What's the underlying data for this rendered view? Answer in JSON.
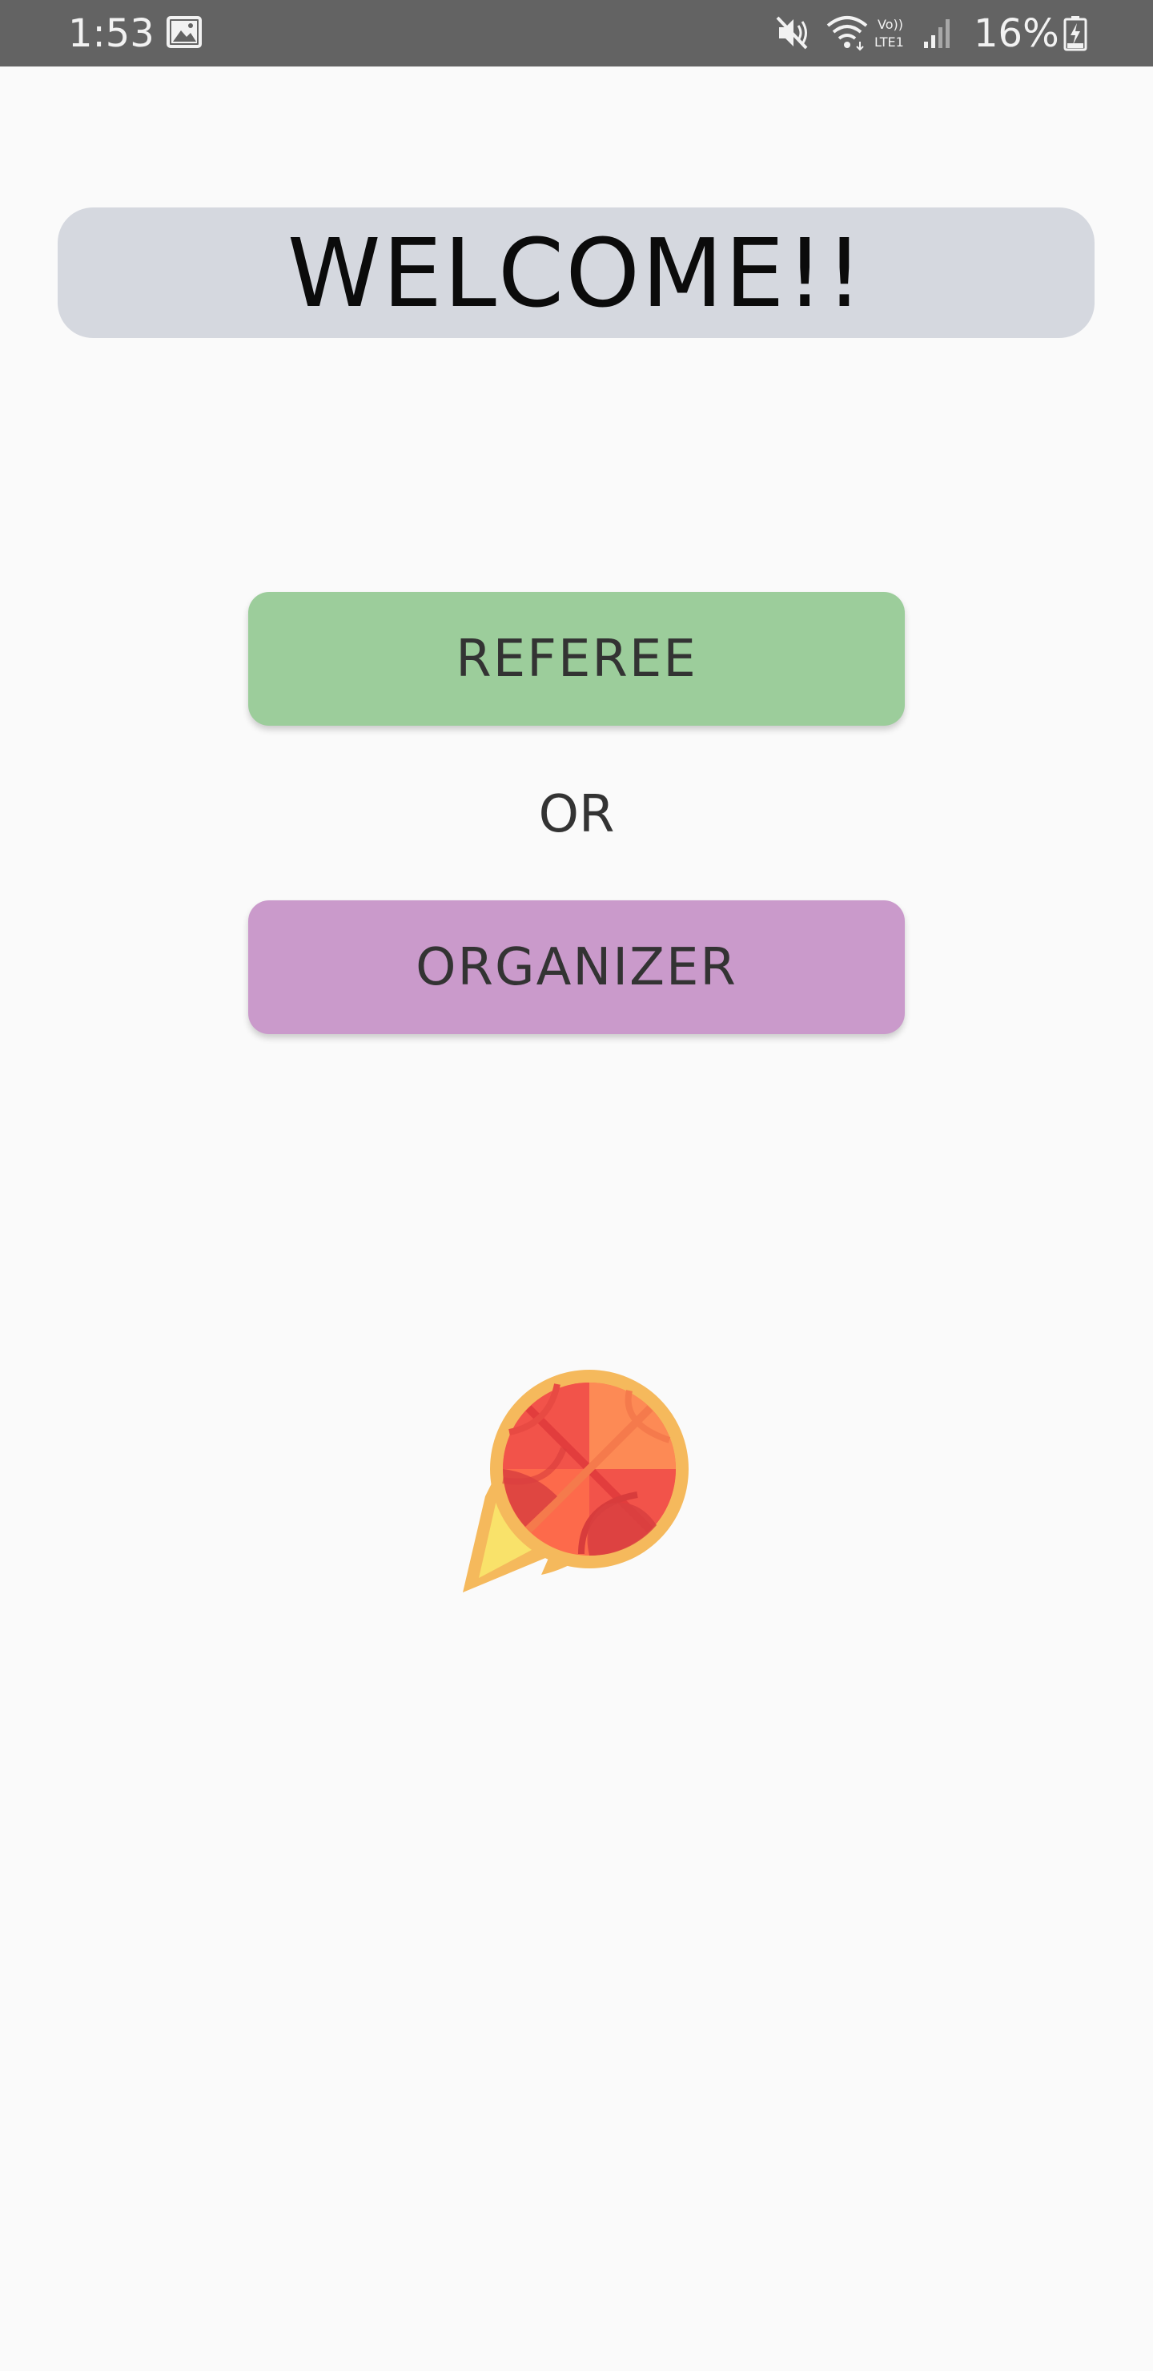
{
  "status_bar": {
    "time": "1:53",
    "battery_percent": "16%",
    "icons": [
      "image-icon",
      "mute-icon",
      "wifi-icon",
      "volte-icon",
      "signal-icon",
      "battery-charging-icon"
    ],
    "background": "#636363"
  },
  "welcome": {
    "title": "WELCOME!!",
    "background": "#d5d8df"
  },
  "roles": {
    "referee_label": "REFEREE",
    "separator": "OR",
    "organizer_label": "ORGANIZER",
    "referee_color": "#9ccd9b",
    "organizer_color": "#ca9acb"
  },
  "logo": {
    "icon": "fireball-basketball-icon"
  }
}
